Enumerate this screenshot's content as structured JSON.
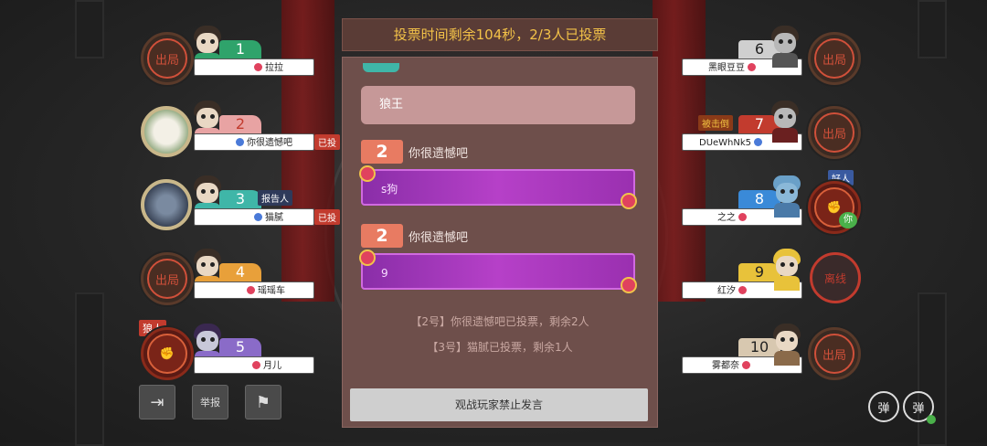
{
  "vote_header": "投票时间剩余104秒，2/3人已投票",
  "options": [
    {
      "label": "狼王"
    }
  ],
  "votes": [
    {
      "voter_num": "2",
      "voter_name": "你很遗憾吧",
      "target": "s狗"
    },
    {
      "voter_num": "2",
      "voter_name": "你很遗憾吧",
      "target": "9"
    }
  ],
  "log": [
    "【2号】你很遗憾吧已投票，剩余2人",
    "【3号】猫腻已投票，剩余1人"
  ],
  "mute_notice": "观战玩家禁止发言",
  "left_players": [
    {
      "num": "1",
      "name": "拉拉",
      "status_badge": "出局",
      "side_tag": "",
      "role_tag": "",
      "color": "#2fa36b"
    },
    {
      "num": "2",
      "name": "你很遗憾吧",
      "status_badge": "",
      "side_tag": "已投",
      "role_tag": "",
      "color": "#e8a3a3"
    },
    {
      "num": "3",
      "name": "猫腻",
      "status_badge": "",
      "side_tag": "已投",
      "role_tag": "报告人",
      "color": "#3fb6a8"
    },
    {
      "num": "4",
      "name": "瑶瑶车",
      "status_badge": "出局",
      "side_tag": "",
      "role_tag": "",
      "color": "#e8a03a"
    },
    {
      "num": "5",
      "name": "月儿",
      "status_badge": "",
      "side_tag": "",
      "role_tag": "狼人",
      "color": "#8a6bc8"
    }
  ],
  "right_players": [
    {
      "num": "6",
      "name": "黑眼豆豆",
      "status_badge": "出局",
      "role_tag": "",
      "color": "#888888"
    },
    {
      "num": "7",
      "name": "DUeWhNk5",
      "status_badge": "出局",
      "role_tag": "被击倒",
      "color": "#c23b2e"
    },
    {
      "num": "8",
      "name": "之之",
      "status_badge": "",
      "role_tag": "好人",
      "extra": "你",
      "color": "#3a8ad8"
    },
    {
      "num": "9",
      "name": "红汐",
      "status_badge": "离线",
      "role_tag": "",
      "color": "#e8c23a"
    },
    {
      "num": "10",
      "name": "雾都奈",
      "status_badge": "出局",
      "role_tag": "",
      "color": "#d8c8b0"
    }
  ],
  "toolbar": {
    "report_label": "举报",
    "danmu_label": "弹",
    "danmu_label_2": "弹"
  }
}
